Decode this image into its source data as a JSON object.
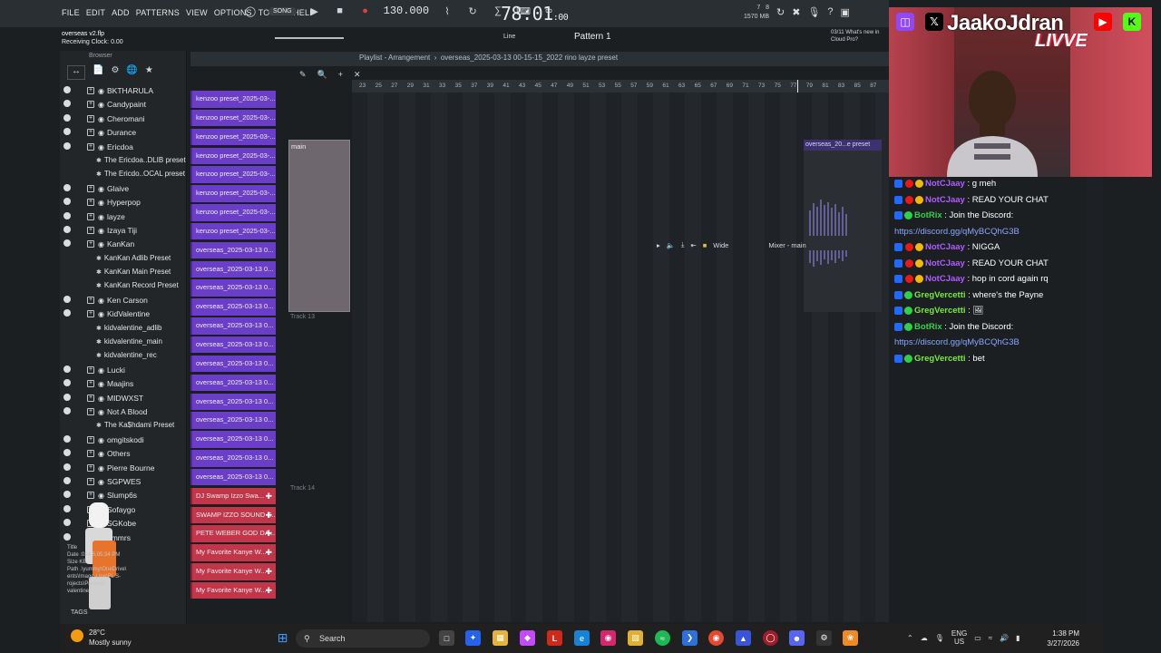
{
  "menu": {
    "items": [
      "FILE",
      "EDIT",
      "ADD",
      "PATTERNS",
      "VIEW",
      "OPTIONS",
      "TOOLS",
      "HELP"
    ]
  },
  "transport": {
    "song_mode": "SONG",
    "bpm": "130.000",
    "time_main": "78:01",
    "time_sub": ":00"
  },
  "cpu": {
    "left": "7",
    "mem": "1570 MB",
    "right": "8"
  },
  "project": {
    "file": "overseas v2.flp",
    "status": "Receiving Clock: 0.00"
  },
  "toolbar": {
    "snap": "Line",
    "pattern": "Pattern 1",
    "news_date": "03/11",
    "news_text": "What's new in",
    "news_text2": "Cloud Pro?"
  },
  "browser": {
    "title": "Browser",
    "items": [
      {
        "label": "BKTHARULA",
        "type": "folder"
      },
      {
        "label": "Candypaint",
        "type": "folder"
      },
      {
        "label": "Cheromani",
        "type": "folder"
      },
      {
        "label": "Durance",
        "type": "folder"
      },
      {
        "label": "Ericdoa",
        "type": "folder"
      },
      {
        "label": "The Ericdoa..DLIB preset",
        "type": "preset"
      },
      {
        "label": "The Ericdo..OCAL preset",
        "type": "preset"
      },
      {
        "label": "Glaive",
        "type": "folder"
      },
      {
        "label": "Hyperpop",
        "type": "folder"
      },
      {
        "label": "layze",
        "type": "folder"
      },
      {
        "label": "Izaya Tiji",
        "type": "folder"
      },
      {
        "label": "KanKan",
        "type": "folder"
      },
      {
        "label": "KanKan Adlib Preset",
        "type": "preset"
      },
      {
        "label": "KanKan Main Preset",
        "type": "preset"
      },
      {
        "label": "KanKan Record Preset",
        "type": "preset"
      },
      {
        "label": "Ken Carson",
        "type": "folder"
      },
      {
        "label": "KidValentine",
        "type": "folder"
      },
      {
        "label": "kidvalentine_adlib",
        "type": "preset"
      },
      {
        "label": "kidvalentine_main",
        "type": "preset"
      },
      {
        "label": "kidvalentine_rec",
        "type": "preset"
      },
      {
        "label": "Lucki",
        "type": "folder"
      },
      {
        "label": "Maajins",
        "type": "folder"
      },
      {
        "label": "MIDWXST",
        "type": "folder"
      },
      {
        "label": "Not A Blood",
        "type": "folder"
      },
      {
        "label": "The Ka$hdami Preset",
        "type": "preset"
      },
      {
        "label": "omgitskodi",
        "type": "folder"
      },
      {
        "label": "Others",
        "type": "folder"
      },
      {
        "label": "Pierre Bourne",
        "type": "folder"
      },
      {
        "label": "SGPWES",
        "type": "folder"
      },
      {
        "label": "Slump6s",
        "type": "folder"
      },
      {
        "label": "Sofaygo",
        "type": "folder"
      },
      {
        "label": "SGKobe",
        "type": "folder"
      },
      {
        "label": "ummrs",
        "type": "folder"
      }
    ],
    "info_lines": [
      "Title",
      "Date    :024 5:05:34 PM",
      "Size      KB",
      "Path  .\\yummy\\OneDrive\\",
      "ents\\Image-Line\\FL S-",
      "rojects\\Presets\\",
      "valentine"
    ],
    "tags_label": "TAGS"
  },
  "channels": [
    {
      "label": "kenzoo preset_2025-03-...",
      "color": "purple"
    },
    {
      "label": "kenzoo preset_2025-03-...",
      "color": "purple"
    },
    {
      "label": "kenzoo preset_2025-03-...",
      "color": "purple"
    },
    {
      "label": "kenzoo preset_2025-03-...",
      "color": "purple"
    },
    {
      "label": "kenzoo preset_2025-03-...",
      "color": "purple"
    },
    {
      "label": "kenzoo preset_2025-03-...",
      "color": "purple"
    },
    {
      "label": "kenzoo preset_2025-03-...",
      "color": "purple"
    },
    {
      "label": "kenzoo preset_2025-03-...",
      "color": "purple"
    },
    {
      "label": "overseas_2025-03-13 0...",
      "color": "purple"
    },
    {
      "label": "overseas_2025-03-13 0...",
      "color": "purple"
    },
    {
      "label": "overseas_2025-03-13 0...",
      "color": "purple"
    },
    {
      "label": "overseas_2025-03-13 0...",
      "color": "purple"
    },
    {
      "label": "overseas_2025-03-13 0...",
      "color": "purple"
    },
    {
      "label": "overseas_2025-03-13 0...",
      "color": "purple"
    },
    {
      "label": "overseas_2025-03-13 0...",
      "color": "purple"
    },
    {
      "label": "overseas_2025-03-13 0...",
      "color": "purple"
    },
    {
      "label": "overseas_2025-03-13 0...",
      "color": "purple"
    },
    {
      "label": "overseas_2025-03-13 0...",
      "color": "purple"
    },
    {
      "label": "overseas_2025-03-13 0...",
      "color": "purple"
    },
    {
      "label": "overseas_2025-03-13 0...",
      "color": "purple"
    },
    {
      "label": "overseas_2025-03-13 0...",
      "color": "purple"
    },
    {
      "label": "DJ Swamp Izzo Swa...",
      "color": "red"
    },
    {
      "label": "SWAMP IZZO SOUND E...",
      "color": "red"
    },
    {
      "label": "PETE WEBER GOD DA...",
      "color": "red"
    },
    {
      "label": "My Favorite Kanye W...",
      "color": "red"
    },
    {
      "label": "My Favorite Kanye W...",
      "color": "red"
    },
    {
      "label": "My Favorite Kanye W...",
      "color": "red"
    }
  ],
  "playlist": {
    "title": "Playlist - Arrangement",
    "path": "overseas_2025-03-13 00-15-15_2022 rino layze preset",
    "ruler": [
      "23",
      "25",
      "27",
      "29",
      "31",
      "33",
      "35",
      "37",
      "39",
      "41",
      "43",
      "45",
      "47",
      "49",
      "51",
      "53",
      "55",
      "57",
      "59",
      "61",
      "63",
      "65",
      "67",
      "69",
      "71",
      "73",
      "75",
      "77",
      "79",
      "81",
      "83",
      "85",
      "87"
    ],
    "main_clip": "main",
    "right_clip": "overseas_20...e preset",
    "track13": "Track 13",
    "track14": "Track 14",
    "mixer_mode": "Wide",
    "mixer_target": "Mixer - main"
  },
  "stream": {
    "name": "JaakoJdran",
    "live": "LIVVE"
  },
  "chat": [
    {
      "user": "NotCJaay",
      "text": " : g meh",
      "color": "purple",
      "badges": 3
    },
    {
      "user": "NotCJaay",
      "text": " : READ YOUR CHAT",
      "color": "purple",
      "badges": 3
    },
    {
      "user": "BotRix",
      "text": " : Join the Discord:",
      "color": "green",
      "badges": 2,
      "link": "https://discord.gg/qMyBCQhG3B"
    },
    {
      "user": "NotCJaay",
      "text": " : NIGGA",
      "color": "purple",
      "badges": 3
    },
    {
      "user": "NotCJaay",
      "text": " : READ YOUR CHAT",
      "color": "purple",
      "badges": 3
    },
    {
      "user": "NotCJaay",
      "text": " : hop in cord again rq",
      "color": "purple",
      "badges": 3
    },
    {
      "user": "GregVercetti",
      "text": " : where's the Payne",
      "color": "lime",
      "badges": 2
    },
    {
      "user": "GregVercetti",
      "text": " : 🖼",
      "color": "lime",
      "badges": 2
    },
    {
      "user": "BotRix",
      "text": " : Join the Discord:",
      "color": "green",
      "badges": 2,
      "link": "https://discord.gg/qMyBCQhG3B"
    },
    {
      "user": "GregVercetti",
      "text": " : bet",
      "color": "lime",
      "badges": 2
    }
  ],
  "taskbar": {
    "weather_temp": "28°C",
    "weather_desc": "Mostly sunny",
    "search": "Search",
    "lang1": "ENG",
    "lang2": "US",
    "time": "1:38 PM",
    "date": "3/27/2026"
  }
}
